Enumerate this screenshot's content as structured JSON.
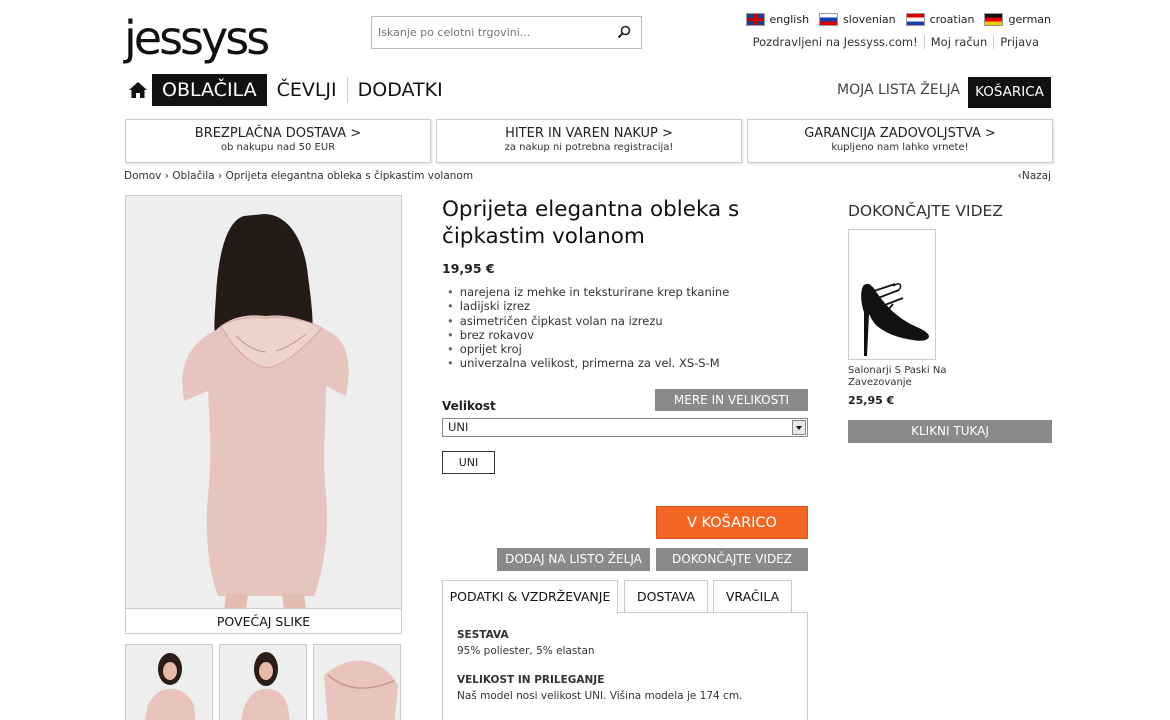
{
  "header": {
    "logo_text": "jessyss",
    "search_placeholder": "Iskanje po celotni trgovini...",
    "languages": [
      {
        "label": "english",
        "flag": "en"
      },
      {
        "label": "slovenian",
        "flag": "sl"
      },
      {
        "label": "croatian",
        "flag": "hr"
      },
      {
        "label": "german",
        "flag": "de"
      }
    ],
    "greeting": "Pozdravljeni na Jessyss.com!",
    "account": "Moj račun",
    "login": "Prijava"
  },
  "nav": {
    "items": [
      "OBLAČILA",
      "ČEVLJI",
      "DODATKI"
    ],
    "wishlist": "MOJA LISTA ŽELJA",
    "cart": "KOŠARICA"
  },
  "banners": [
    {
      "title": "BREZPLAČNA DOSTAVA  >",
      "sub": "ob nakupu nad 50 EUR"
    },
    {
      "title": "HITER IN VAREN NAKUP  >",
      "sub": "za nakup ni potrebna registracija!"
    },
    {
      "title": "GARANCIJA ZADOVOLJSTVA  >",
      "sub": "kupljeno nam lahko vrnete!"
    }
  ],
  "breadcrumb": {
    "items": [
      "Domov",
      "Oblačila",
      "Oprijeta elegantna obleka s čipkastim volanom"
    ],
    "back": "Nazaj"
  },
  "product": {
    "title": "Oprijeta elegantna obleka s čipkastim volanom",
    "price": "19,95 €",
    "features": [
      "narejena iz mehke in teksturirane krep tkanine",
      "ladijski izrez",
      "asimetričen čipkast volan na izrezu",
      "brez rokavov",
      "oprijet kroj",
      "univerzalna velikost, primerna za vel. XS-S-M"
    ],
    "enlarge": "POVEČAJ SLIKE",
    "size_label": "Velikost",
    "measure_button": "MERE IN VELIKOSTI",
    "size_selected": "UNI",
    "size_chip": "UNI",
    "add_to_cart": "V KOŠARICO",
    "add_wishlist": "DODAJ NA LISTO ŽELJA",
    "complete_look": "DOKONČAJTE VIDEZ"
  },
  "tabs": {
    "items": [
      "PODATKI & VZDRŽEVANJE",
      "DOSTAVA",
      "VRAČILA"
    ],
    "sections": [
      {
        "title": "SESTAVA",
        "text": "95% poliester, 5% elastan"
      },
      {
        "title": "VELIKOST IN PRILEGANJE",
        "text": "Naš model nosi velikost UNI. Višina modela je 174 cm."
      }
    ]
  },
  "look": {
    "title": "DOKONČAJTE VIDEZ",
    "item_name": "Salonarji S Paski Na Zavezovanje",
    "item_price": "25,95 €",
    "button": "KLIKNI TUKAJ"
  },
  "colors": {
    "accent_orange": "#f36522",
    "gray_button": "#8a8a8a",
    "dark": "#111111"
  }
}
